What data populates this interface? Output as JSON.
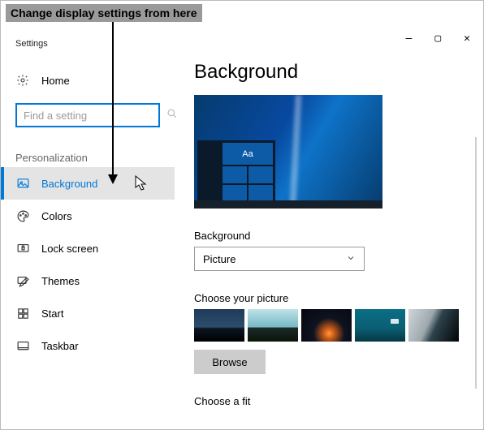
{
  "annotation": {
    "text": "Change display settings from here"
  },
  "window": {
    "title": "Settings",
    "controls": {
      "minimize": "—",
      "maximize": "▢",
      "close": "✕"
    }
  },
  "sidebar": {
    "home_label": "Home",
    "search_placeholder": "Find a setting",
    "section_label": "Personalization",
    "items": [
      {
        "label": "Background",
        "selected": true
      },
      {
        "label": "Colors"
      },
      {
        "label": "Lock screen"
      },
      {
        "label": "Themes"
      },
      {
        "label": "Start"
      },
      {
        "label": "Taskbar"
      }
    ]
  },
  "content": {
    "page_title": "Background",
    "preview_sample_text": "Aa",
    "background_label": "Background",
    "background_value": "Picture",
    "choose_picture_label": "Choose your picture",
    "browse_label": "Browse",
    "choose_fit_label": "Choose a fit"
  }
}
